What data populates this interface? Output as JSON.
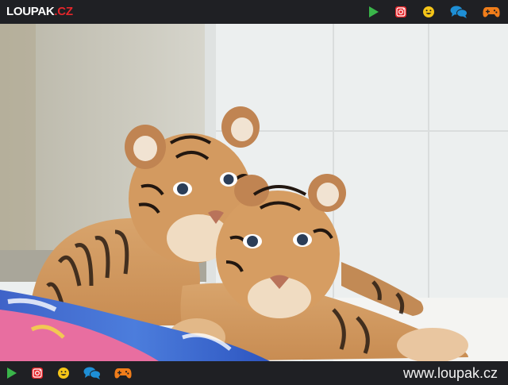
{
  "header": {
    "logo_main": "LOUPAK",
    "logo_dot": ".",
    "logo_tld": "CZ",
    "icons": [
      "play-icon",
      "instagram-icon",
      "smiley-icon",
      "chat-icon",
      "gamepad-icon"
    ]
  },
  "footer": {
    "icons": [
      "play-icon",
      "instagram-icon",
      "smiley-icon",
      "chat-icon",
      "gamepad-icon"
    ],
    "url": "www.loupak.cz"
  },
  "colors": {
    "bar_bg": "#1f2024",
    "play": "#3ab54a",
    "instagram": "#e5262b",
    "smiley": "#f5c518",
    "chat": "#1e8fd6",
    "gamepad": "#f07d1a"
  }
}
